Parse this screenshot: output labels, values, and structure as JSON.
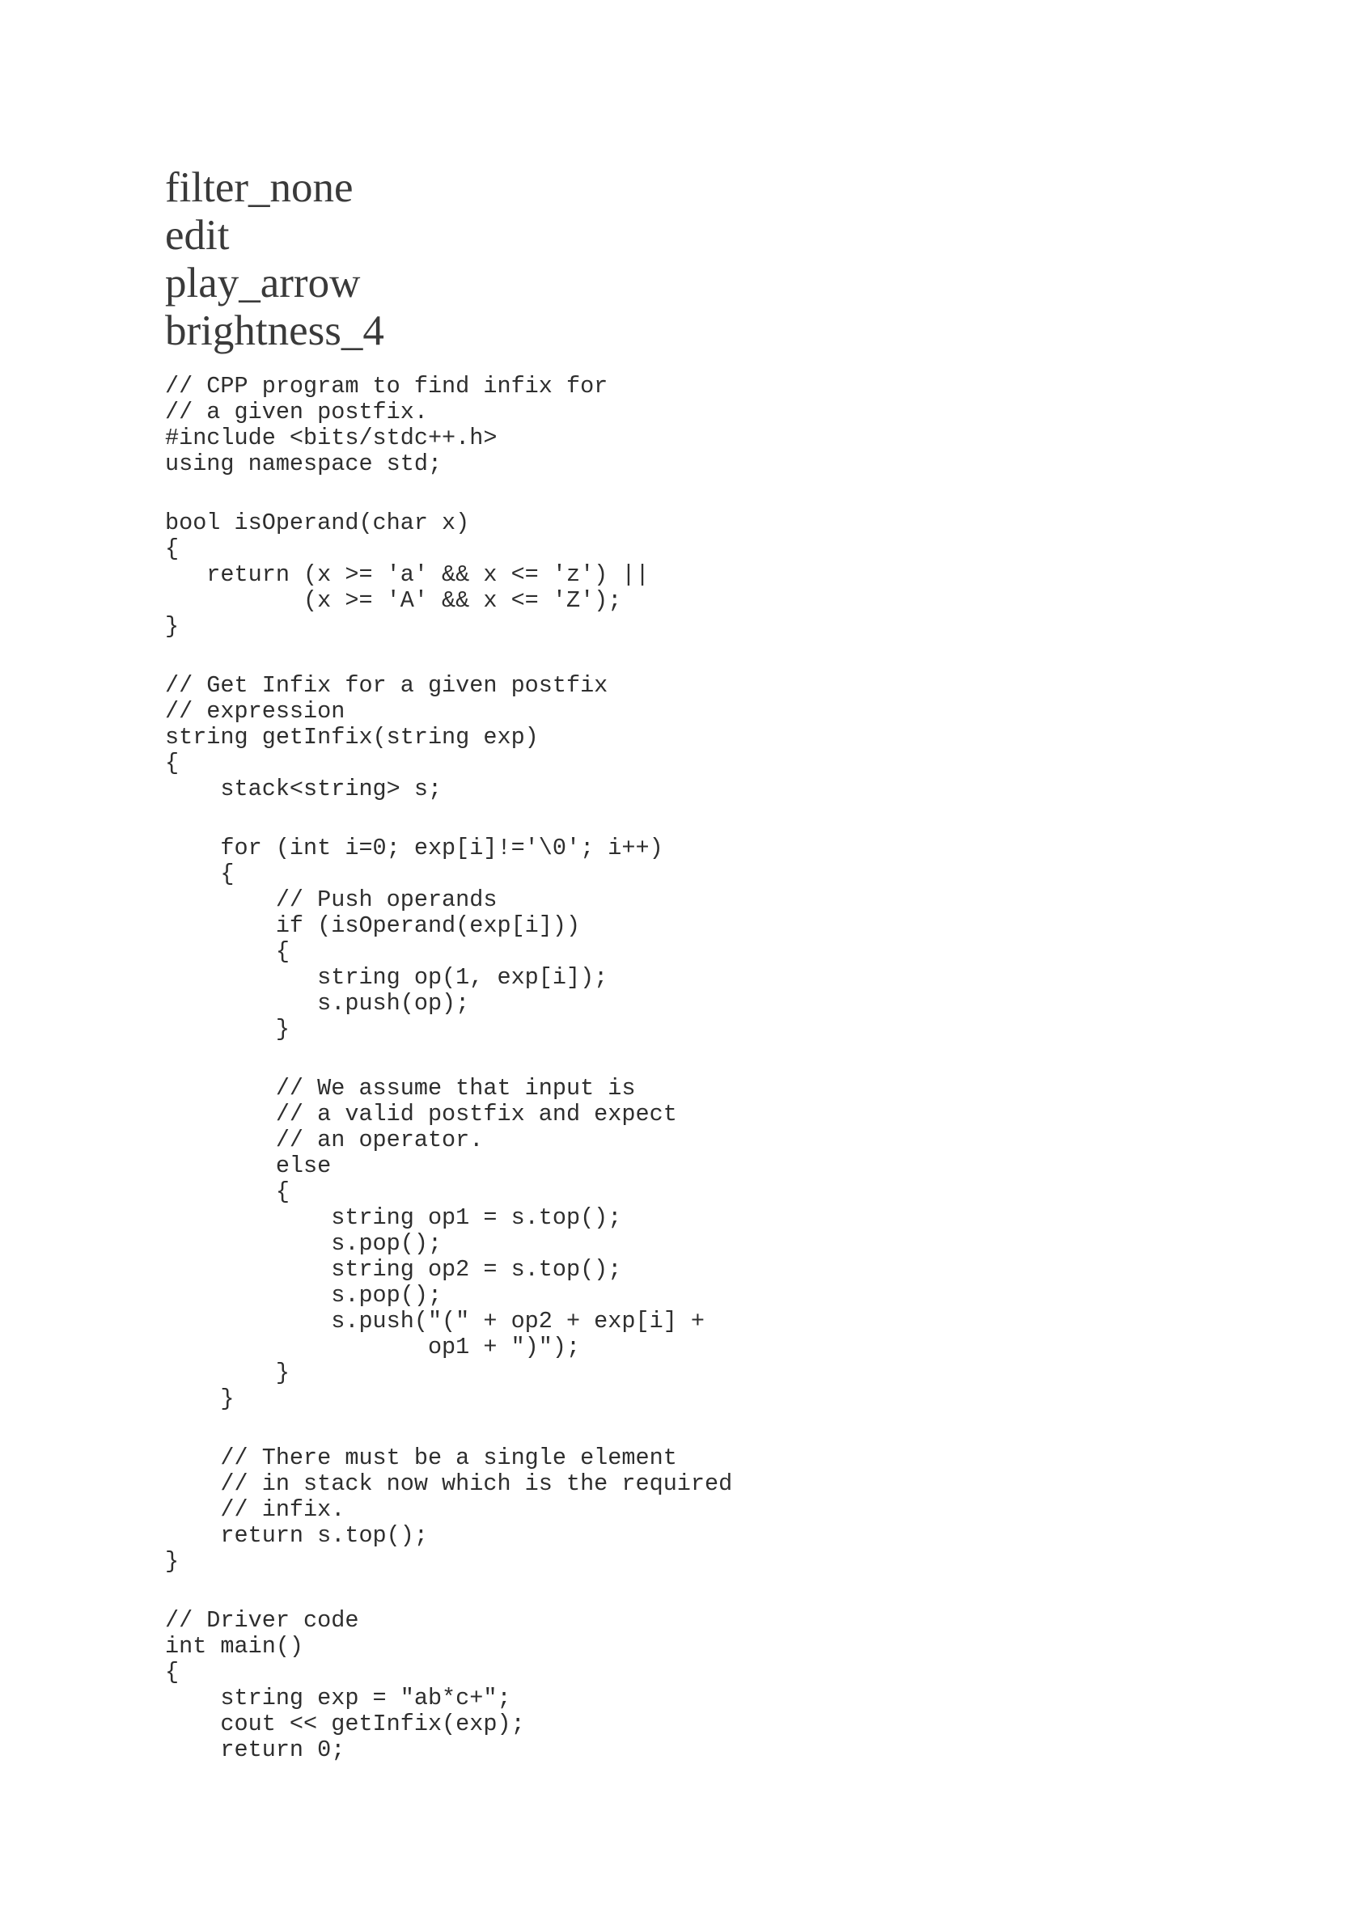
{
  "toolbar": {
    "filter_label": "filter_none",
    "edit_label": "edit",
    "run_label": "play_arrow",
    "theme_label": "brightness_4"
  },
  "code": {
    "lines": [
      "// CPP program to find infix for",
      "// a given postfix.",
      "#include <bits/stdc++.h>",
      "using namespace std;",
      "bool isOperand(char x)",
      "{",
      "   return (x >= 'a' && x <= 'z') ||",
      "          (x >= 'A' && x <= 'Z');",
      "}",
      "// Get Infix for a given postfix",
      "// expression",
      "string getInfix(string exp)",
      "{",
      "    stack<string> s;",
      "    for (int i=0; exp[i]!='\\0'; i++)",
      "    {",
      "        // Push operands",
      "        if (isOperand(exp[i]))",
      "        {",
      "           string op(1, exp[i]);",
      "           s.push(op);",
      "        }",
      "        // We assume that input is",
      "        // a valid postfix and expect",
      "        // an operator.",
      "        else",
      "        {",
      "            string op1 = s.top();",
      "            s.pop();",
      "            string op2 = s.top();",
      "            s.pop();",
      "            s.push(\"(\" + op2 + exp[i] +",
      "                   op1 + \")\");",
      "        }",
      "    }",
      "    // There must be a single element",
      "    // in stack now which is the required",
      "    // infix.",
      "    return s.top();",
      "}",
      "// Driver code",
      "int main()",
      "{",
      "    string exp = \"ab*c+\";",
      "    cout << getInfix(exp);",
      "    return 0;"
    ]
  }
}
